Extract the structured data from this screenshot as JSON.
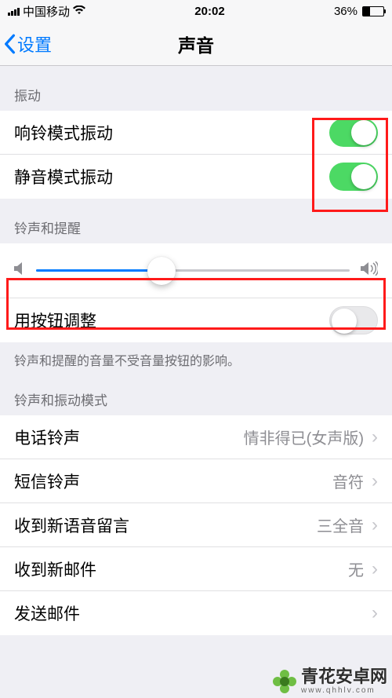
{
  "status": {
    "carrier": "中国移动",
    "time": "20:02",
    "battery_pct": "36%"
  },
  "nav": {
    "back_label": "设置",
    "title": "声音"
  },
  "sections": {
    "vibration_header": "振动",
    "ring_vibrate_label": "响铃模式振动",
    "silent_vibrate_label": "静音模式振动",
    "ringer_header": "铃声和提醒",
    "button_adjust_label": "用按钮调整",
    "ringer_footer": "铃声和提醒的音量不受音量按钮的影响。",
    "patterns_header": "铃声和振动模式"
  },
  "rows": {
    "ringtone": {
      "label": "电话铃声",
      "value": "情非得已(女声版)"
    },
    "text_tone": {
      "label": "短信铃声",
      "value": "音符"
    },
    "voicemail": {
      "label": "收到新语音留言",
      "value": "三全音"
    },
    "new_mail": {
      "label": "收到新邮件",
      "value": "无"
    },
    "sent_mail": {
      "label": "发送邮件",
      "value": ""
    }
  },
  "toggles": {
    "ring_vibrate": true,
    "silent_vibrate": true,
    "button_adjust": false
  },
  "slider": {
    "volume_pct": 40
  },
  "watermark": {
    "text": "青花安卓网",
    "url": "www.qhhlv.com"
  }
}
